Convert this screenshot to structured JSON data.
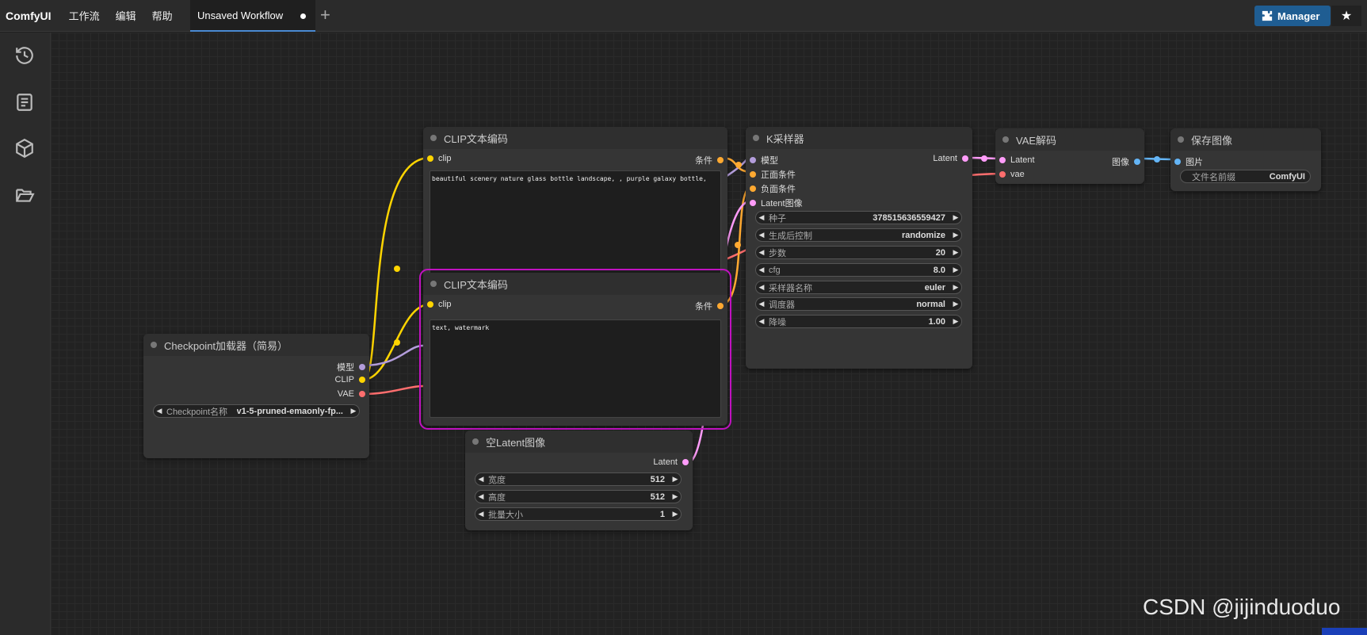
{
  "app": {
    "logo": "ComfyUI"
  },
  "menu": [
    "工作流",
    "编辑",
    "帮助"
  ],
  "tab": {
    "label": "Unsaved Workflow"
  },
  "manager": {
    "label": "Manager"
  },
  "sidebar": {
    "icons": [
      "history-icon",
      "book-icon",
      "cube-icon",
      "folder-open-icon"
    ]
  },
  "nodes": {
    "clip_pos": {
      "title": "CLIP文本编码",
      "in_clip": "clip",
      "out_cond": "条件",
      "text": "beautiful scenery nature glass bottle landscape, , purple galaxy bottle,"
    },
    "clip_neg": {
      "title": "CLIP文本编码",
      "in_clip": "clip",
      "out_cond": "条件",
      "text": "text, watermark"
    },
    "checkpoint": {
      "title": "Checkpoint加载器（简易）",
      "out_model": "模型",
      "out_clip": "CLIP",
      "out_vae": "VAE",
      "w_label": "Checkpoint名称",
      "w_value": "v1-5-pruned-emaonly-fp..."
    },
    "ksampler": {
      "title": "K采样器",
      "in_model": "模型",
      "in_pos": "正面条件",
      "in_neg": "负面条件",
      "in_latent": "Latent图像",
      "out_latent": "Latent",
      "widgets": [
        {
          "label": "种子",
          "value": "378515636559427"
        },
        {
          "label": "生成后控制",
          "value": "randomize"
        },
        {
          "label": "步数",
          "value": "20"
        },
        {
          "label": "cfg",
          "value": "8.0"
        },
        {
          "label": "采样器名称",
          "value": "euler"
        },
        {
          "label": "调度器",
          "value": "normal"
        },
        {
          "label": "降噪",
          "value": "1.00"
        }
      ]
    },
    "vae": {
      "title": "VAE解码",
      "in_latent": "Latent",
      "in_vae": "vae",
      "out_image": "图像"
    },
    "save": {
      "title": "保存图像",
      "in_image": "图片",
      "w_label": "文件名前缀",
      "w_value": "ComfyUI"
    },
    "latent": {
      "title": "空Latent图像",
      "out_latent": "Latent",
      "widgets": [
        {
          "label": "宽度",
          "value": "512"
        },
        {
          "label": "高度",
          "value": "512"
        },
        {
          "label": "批量大小",
          "value": "1"
        }
      ]
    }
  },
  "watermark": "CSDN @jijinduoduo",
  "colors": {
    "clip": "#ffd500",
    "model": "#b39ddb",
    "vae": "#ff6e6e",
    "cond": "#ffa931",
    "latent": "#ff9cf9",
    "image": "#64b5f6",
    "selected": "#c012c0"
  }
}
